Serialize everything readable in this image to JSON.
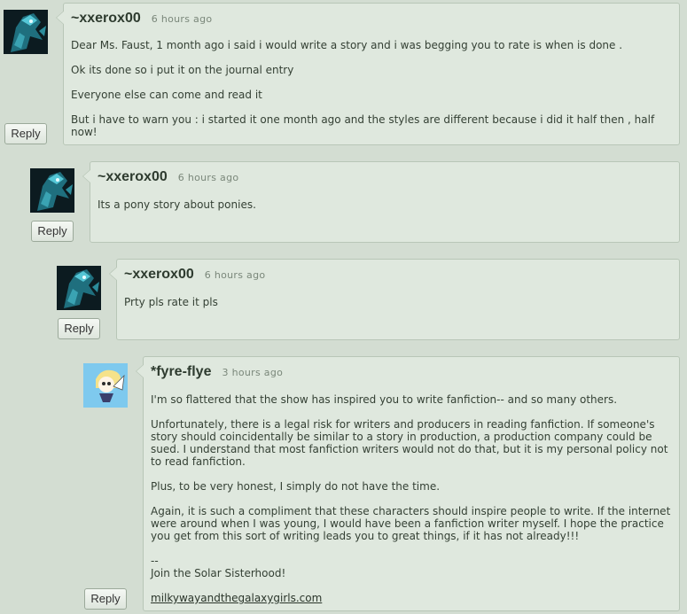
{
  "comments": [
    {
      "author": "~xxerox00",
      "time": "6 hours ago",
      "avatar": "dark-pony-avatar",
      "paragraphs": [
        "Dear Ms. Faust, 1 month ago i said i would write a story and i was begging you to rate is when is done .",
        "Ok its done so i put it on the journal entry",
        "Everyone else can come and read it",
        "But i have to warn you : i started it one month ago and the styles are different because i did it half then , half now!"
      ],
      "reply_label": "Reply"
    },
    {
      "author": "~xxerox00",
      "time": "6 hours ago",
      "avatar": "dark-pony-avatar",
      "paragraphs": [
        "Its a pony story about ponies."
      ],
      "reply_label": "Reply"
    },
    {
      "author": "~xxerox00",
      "time": "6 hours ago",
      "avatar": "dark-pony-avatar",
      "paragraphs": [
        "Prty pls rate it pls"
      ],
      "reply_label": "Reply"
    },
    {
      "author": "*fyre-flye",
      "time": "3 hours ago",
      "avatar": "cartoon-girl-avatar",
      "paragraphs": [
        "I'm so flattered that the show has inspired you to write fanfiction-- and so many others.",
        "Unfortunately, there is a legal risk for writers and producers in reading fanfiction. If someone's story should coincidentally be similar to a story in production, a production company could be sued. I understand that most fanfiction writers would not do that, but it is my personal policy not to read fanfiction.",
        "Plus, to be very honest, I simply do not have the time.",
        "Again, it is such a compliment that these characters should inspire people to write. If the internet were around when I was young, I would have been a fanfiction writer myself. I hope the practice you get from this sort of writing leads you to great things, if it has not already!!!"
      ],
      "signature": {
        "separator": "--",
        "line": "Join the Solar Sisterhood!",
        "link": "milkywayandthegalaxygirls.com"
      },
      "reply_label": "Reply"
    }
  ]
}
